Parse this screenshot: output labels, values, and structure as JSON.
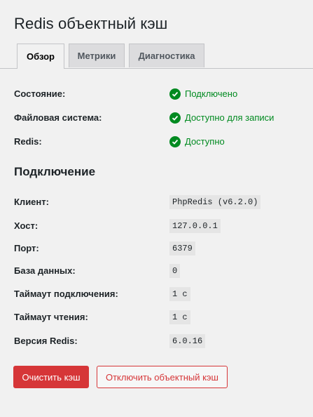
{
  "page": {
    "title": "Redis объектный кэш"
  },
  "tabs": [
    {
      "label": "Обзор",
      "active": true
    },
    {
      "label": "Метрики",
      "active": false
    },
    {
      "label": "Диагностика",
      "active": false
    }
  ],
  "status": [
    {
      "label": "Состояние:",
      "value": "Подключено",
      "icon": "check-circle-icon"
    },
    {
      "label": "Файловая система:",
      "value": "Доступно для записи",
      "icon": "check-circle-icon"
    },
    {
      "label": "Redis:",
      "value": "Доступно",
      "icon": "check-circle-icon"
    }
  ],
  "connection": {
    "heading": "Подключение",
    "rows": [
      {
        "label": "Клиент:",
        "value": "PhpRedis (v6.2.0)"
      },
      {
        "label": "Хост:",
        "value": "127.0.0.1"
      },
      {
        "label": "Порт:",
        "value": "6379"
      },
      {
        "label": "База данных:",
        "value": "0"
      },
      {
        "label": "Таймаут подключения:",
        "value": "1 с"
      },
      {
        "label": "Таймаут чтения:",
        "value": "1 с"
      },
      {
        "label": "Версия Redis:",
        "value": "6.0.16"
      }
    ]
  },
  "actions": {
    "flush_label": "Очистить кэш",
    "disable_label": "Отключить объектный кэш"
  },
  "colors": {
    "success": "#008a20",
    "danger": "#d63638"
  }
}
